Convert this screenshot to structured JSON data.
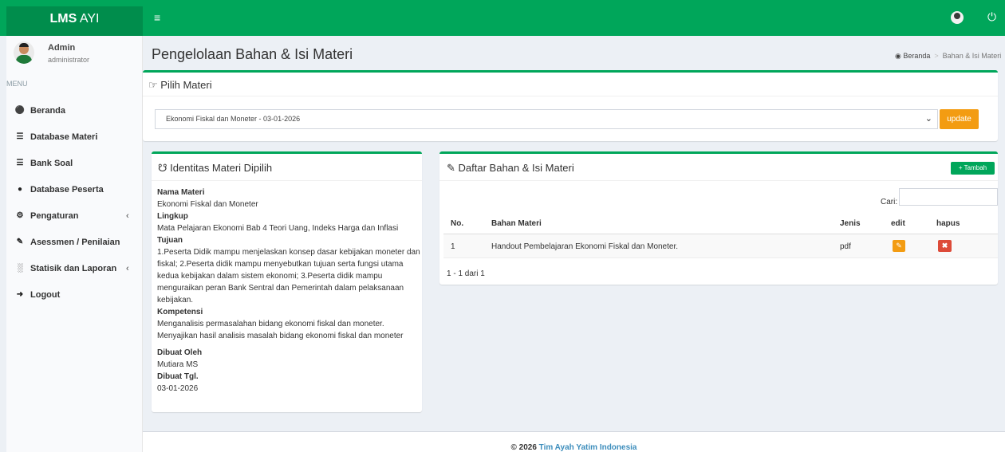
{
  "brand": {
    "bold": "LMS",
    "rest": " AYI",
    "color": "#00a65a"
  },
  "user": {
    "name": "Admin",
    "role": "administrator"
  },
  "menu": {
    "header": "MENU",
    "items": [
      {
        "label": "Beranda",
        "icon": "home-icon"
      },
      {
        "label": "Database Materi",
        "icon": "database-icon"
      },
      {
        "label": "Bank Soal",
        "icon": "database-icon"
      },
      {
        "label": "Database Peserta",
        "icon": "users-icon"
      },
      {
        "label": "Pengaturan",
        "icon": "gear-icon",
        "chevron": "‹"
      },
      {
        "label": "Asessmen / Penilaian",
        "icon": "edit-icon"
      },
      {
        "label": "Statisik dan Laporan",
        "icon": "bar-chart-icon",
        "chevron": "‹"
      },
      {
        "label": "Logout",
        "icon": "sign-out-icon"
      }
    ]
  },
  "page": {
    "title": "Pengelolaan Bahan & Isi Materi",
    "breadcrumb": {
      "home": "Beranda",
      "current": "Bahan & Isi Materi"
    }
  },
  "pilih": {
    "title": "Pilih Materi",
    "selected": "Ekonomi Fiskal dan Moneter - 03-01-2026",
    "button": "update"
  },
  "identitas": {
    "title": "Identitas Materi Dipilih",
    "nama_label": "Nama Materi",
    "nama": "Ekonomi Fiskal dan Moneter",
    "lingkup_label": "Lingkup",
    "lingkup": "Mata Pelajaran Ekonomi Bab 4 Teori Uang, Indeks Harga dan Inflasi",
    "tujuan_label": "Tujuan",
    "tujuan": "1.Peserta Didik mampu menjelaskan konsep dasar kebijakan moneter dan fiskal; 2.Peserta didik mampu menyebutkan tujuan serta fungsi utama kedua kebijakan dalam sistem ekonomi; 3.Peserta didik mampu menguraikan peran Bank Sentral dan Pemerintah dalam pelaksanaan kebijakan.",
    "kompetensi_label": "Kompetensi",
    "kompetensi": "Menganalisis permasalahan bidang ekonomi fiskal dan moneter. Menyajikan hasil analisis masalah bidang ekonomi fiskal dan moneter",
    "dibuat_oleh_label": "Dibuat Oleh",
    "dibuat_oleh": "Mutiara MS",
    "dibuat_tgl_label": "Dibuat Tgl.",
    "dibuat_tgl": "03-01-2026"
  },
  "daftar": {
    "title": "Daftar Bahan & Isi Materi",
    "add_button": "Tambah",
    "search_label": "Cari:",
    "search_value": "",
    "columns": [
      "No.",
      "Bahan Materi",
      "Jenis",
      "edit",
      "hapus"
    ],
    "rows": [
      {
        "no": "1",
        "bahan": "Handout Pembelajaran Ekonomi Fiskal dan Moneter.",
        "jenis": "pdf"
      }
    ],
    "pagination": "1 - 1 dari 1"
  },
  "footer": {
    "prefix": "© 2026 ",
    "link": "Tim Ayah Yatim Indonesia"
  }
}
